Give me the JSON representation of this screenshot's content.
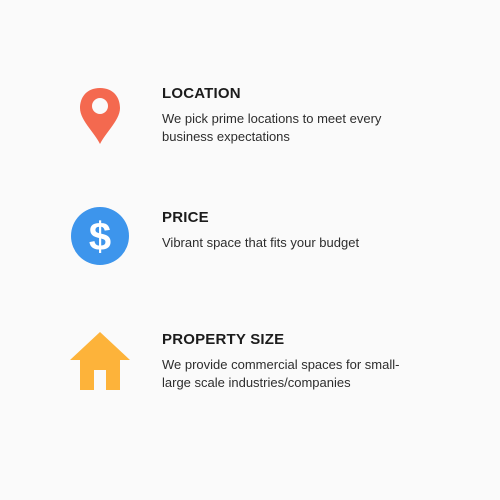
{
  "colors": {
    "location_icon": "#f4694f",
    "price_icon": "#3d95ec",
    "size_icon": "#fdb33a",
    "background": "#fafafa"
  },
  "features": [
    {
      "icon": "location-pin-icon",
      "title": "LOCATION",
      "description": "We pick prime locations to meet every business expectations"
    },
    {
      "icon": "dollar-icon",
      "title": "PRICE",
      "description": "Vibrant space that fits your budget"
    },
    {
      "icon": "house-icon",
      "title": "PROPERTY SIZE",
      "description": "We provide commercial spaces for small-large scale industries/companies"
    }
  ]
}
